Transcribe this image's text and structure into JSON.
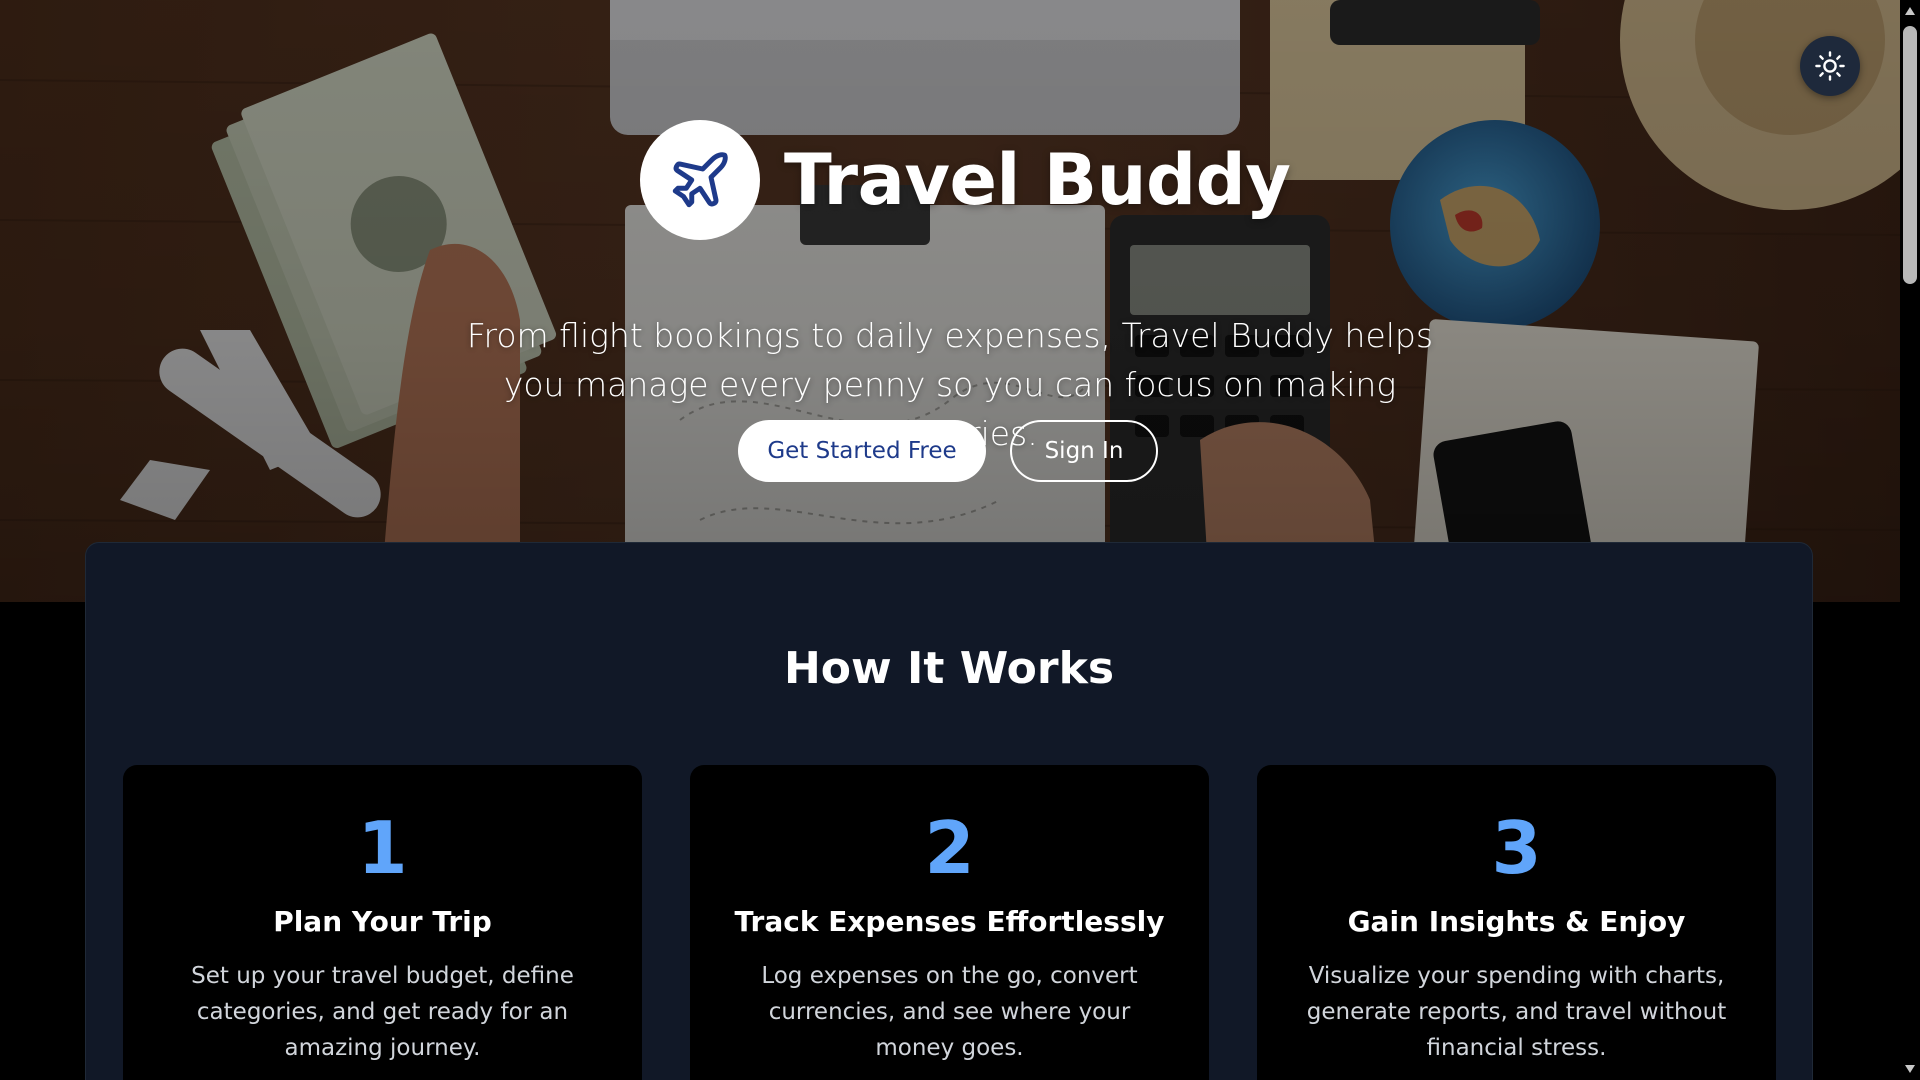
{
  "brand": {
    "title": "Travel Buddy",
    "logo_icon": "airplane-icon",
    "accent_color": "#1e3a8a"
  },
  "theme_toggle": {
    "icon": "sun-icon"
  },
  "hero": {
    "tagline": "From flight bookings to daily expenses, Travel Buddy helps you manage every penny so you can focus on making memories.",
    "primary_button": "Get Started Free",
    "secondary_button": "Sign In"
  },
  "how_it_works": {
    "title": "How It Works",
    "number_color": "#60a5fa",
    "steps": [
      {
        "number": "1",
        "title": "Plan Your Trip",
        "description": "Set up your travel budget, define categories, and get ready for an amazing journey."
      },
      {
        "number": "2",
        "title": "Track Expenses Effortlessly",
        "description": "Log expenses on the go, convert currencies, and see where your money goes."
      },
      {
        "number": "3",
        "title": "Gain Insights & Enjoy",
        "description": "Visualize your spending with charts, generate reports, and travel without financial stress."
      }
    ]
  }
}
